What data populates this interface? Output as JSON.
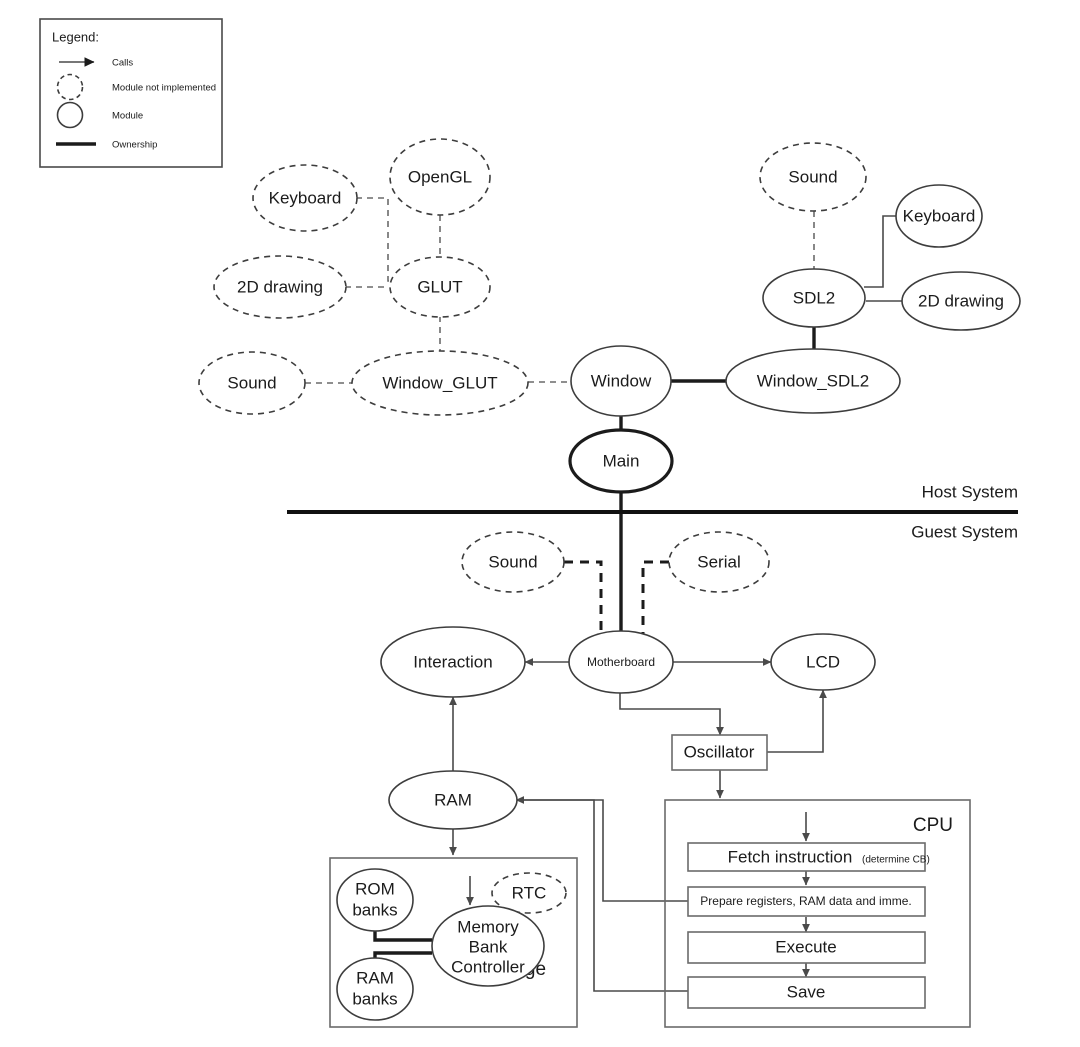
{
  "legend": {
    "title": "Legend:",
    "items": [
      {
        "key": "calls",
        "label": "Calls",
        "symbol": "arrow"
      },
      {
        "key": "not-implemented",
        "label": "Module not implemented",
        "symbol": "dashed-circle"
      },
      {
        "key": "module",
        "label": "Module",
        "symbol": "circle"
      },
      {
        "key": "ownership",
        "label": "Ownership",
        "symbol": "thick-line"
      }
    ]
  },
  "divider": {
    "above_label": "Host System",
    "below_label": "Guest System"
  },
  "host": {
    "glut_cluster": {
      "keyboard": "Keyboard",
      "opengl": "OpenGL",
      "two_d_drawing": "2D drawing",
      "glut": "GLUT",
      "sound": "Sound",
      "window_glut": "Window_GLUT"
    },
    "sdl_cluster": {
      "sound": "Sound",
      "keyboard": "Keyboard",
      "sdl2": "SDL2",
      "two_d_drawing": "2D drawing",
      "window_sdl2": "Window_SDL2"
    },
    "window": "Window",
    "main": "Main"
  },
  "guest": {
    "sound": "Sound",
    "serial": "Serial",
    "motherboard": "Motherboard",
    "interaction": "Interaction",
    "lcd": "LCD",
    "oscillator": "Oscillator",
    "ram": "RAM",
    "cartridge": {
      "title": "Cartridge",
      "rom_banks_line1": "ROM",
      "rom_banks_line2": "banks",
      "ram_banks_line1": "RAM",
      "ram_banks_line2": "banks",
      "rtc": "RTC",
      "mbc_line1": "Memory",
      "mbc_line2": "Bank",
      "mbc_line3": "Controller"
    },
    "cpu": {
      "title": "CPU",
      "stages": [
        {
          "main": "Fetch instruction",
          "sub": "(determine CB)"
        },
        {
          "main": "Prepare registers, RAM data and imme.",
          "sub": ""
        },
        {
          "main": "Execute",
          "sub": ""
        },
        {
          "main": "Save",
          "sub": ""
        }
      ]
    }
  },
  "colors": {
    "stroke": "#3d3d3d",
    "edge": "#4a4a4a",
    "text": "#1b1b1b",
    "background": "#ffffff",
    "bold_stroke": "#1b1b1b"
  }
}
